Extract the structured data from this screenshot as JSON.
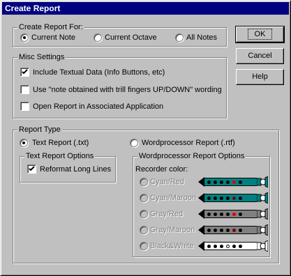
{
  "window": {
    "title": "Create Report"
  },
  "buttons": {
    "ok": "OK",
    "cancel": "Cancel",
    "help": "Help"
  },
  "report_for": {
    "title": "Create Report For:",
    "options": [
      "Current Note",
      "Current Octave",
      "All Notes"
    ],
    "selected": "Current Note"
  },
  "misc": {
    "title": "Misc Settings",
    "items": [
      {
        "label": "Include Textual Data (Info Buttons, etc)",
        "checked": true
      },
      {
        "label": "Use \"note obtained with trill fingers UP/DOWN\" wording",
        "checked": false
      },
      {
        "label": "Open Report in Associated Application",
        "checked": false
      }
    ]
  },
  "report_type": {
    "title": "Report Type",
    "text_option": "Text Report (.txt)",
    "rtf_option": "Wordprocessor Report (.rtf)",
    "selected": "Text Report (.txt)",
    "text_options": {
      "title": "Text Report Options",
      "reformat_label": "Reformat Long Lines",
      "reformat_checked": true
    },
    "wp_options": {
      "title": "Wordprocessor Report Options",
      "color_label": "Recorder color:",
      "colors": [
        {
          "label": "Cyan/Red",
          "body": "#008080",
          "accent": "#e00000"
        },
        {
          "label": "Cyan/Maroon",
          "body": "#008080",
          "accent": "#800000"
        },
        {
          "label": "Gray/Red",
          "body": "#808080",
          "accent": "#e00000"
        },
        {
          "label": "Gray/Maroon",
          "body": "#808080",
          "accent": "#800000"
        },
        {
          "label": "Black&White",
          "body": "#ffffff",
          "accent": "#000000"
        }
      ]
    }
  }
}
